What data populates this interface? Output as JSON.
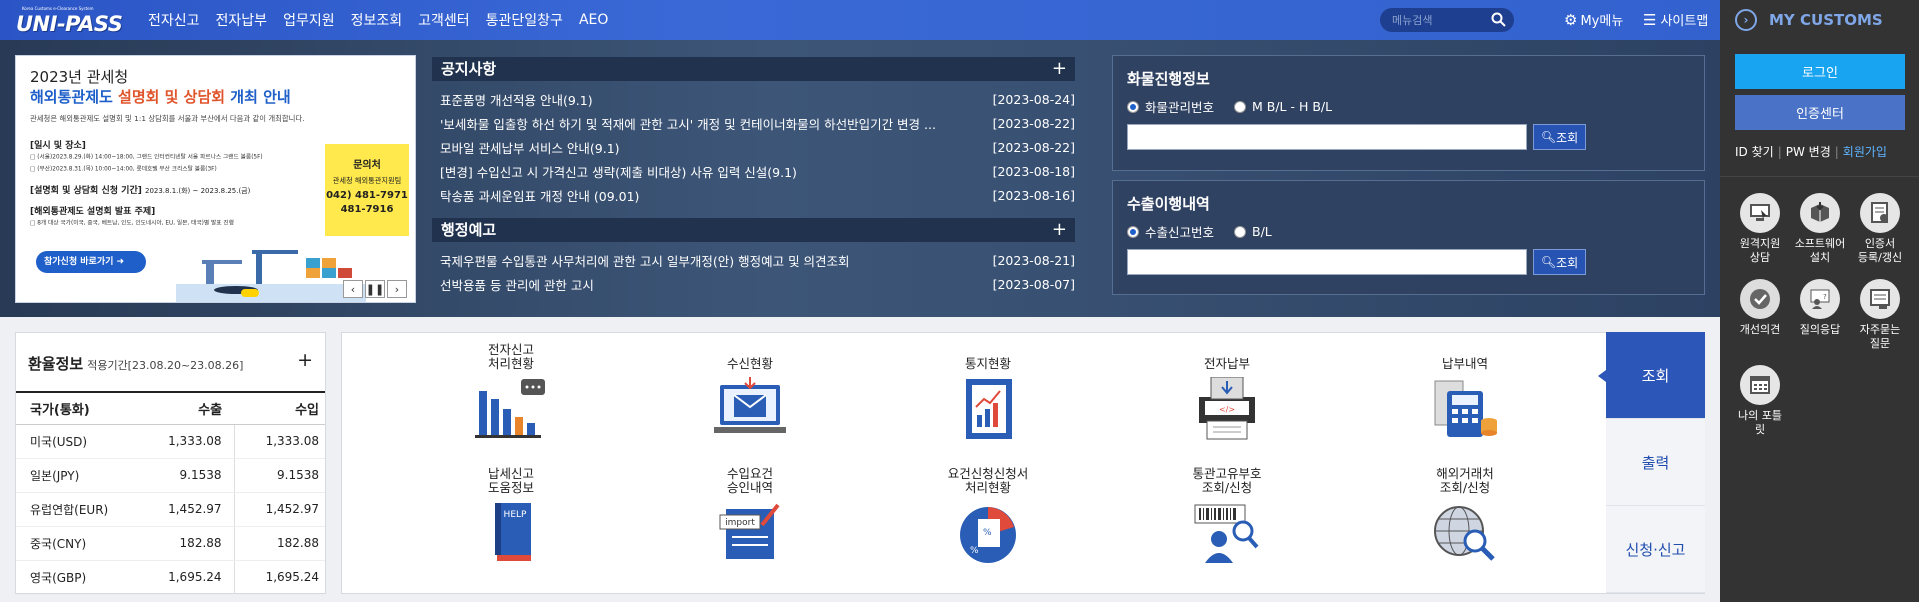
{
  "header": {
    "logo_text": "UNI-PASS",
    "logo_subtitle": "Korea Customs e-Clearance System",
    "nav": [
      "전자신고",
      "전자납부",
      "업무지원",
      "정보조회",
      "고객센터",
      "통관단일창구",
      "AEO"
    ],
    "search_placeholder": "메뉴검색",
    "my_menu": "My메뉴",
    "sitemap": "사이트맵"
  },
  "banner": {
    "line1": "2023년 관세청",
    "line2a": "해외통관제도 ",
    "line2b": "설명회 및 상담회",
    "line2c": " 개최 안내",
    "desc": "관세청은 해외통관제도 설명회 및 1:1 상담회를 서울과 부산에서 다음과 같이 개최합니다.",
    "sec1": "[일시 및 장소]",
    "sec1_l1": "□ (서울)2023.8.29.(화) 14:00~18:00, 그랜드 인터컨티넨탈 서울 파르나스 그랜드 볼룸(5F)",
    "sec1_l2": "□ (부산)2023.8.31.(목) 10:00~14:00, 롯데호텔 부산 크리스탈 볼룸(3F)",
    "sec2": "[설명회 및 상담회 신청 기간]",
    "sec2_val": "2023.8.1.(화) ~ 2023.8.25.(금)",
    "sec3": "[해외통관제도 설명회 발표 주제]",
    "sec3_l1": "□ 8개 대상 국가(미국, 중국, 베트남, 인도, 인도네시아, EU, 일본, 태국)별 발표 진행",
    "contact_title": "문의처",
    "contact_org": "관세청 해외통관지원팀",
    "contact_tel1": "042) 481-7971",
    "contact_tel2": "481-7916",
    "apply_btn": "참가신청 바로가기"
  },
  "notice": {
    "title": "공지사항",
    "items": [
      {
        "title": "표준품명 개선적용 안내(9.1)",
        "date": "[2023-08-24]"
      },
      {
        "title": "'보세화물 입출항 하선 하기 및 적재에 관한 고시' 개정 및 컨테이너화물의 하선반입기간 변경 ...",
        "date": "[2023-08-22]"
      },
      {
        "title": "모바일 관세납부 서비스 안내(9.1)",
        "date": "[2023-08-22]"
      },
      {
        "title": "[변경] 수입신고 시 가격신고 생략(제출 비대상) 사유 입력 신설(9.1)",
        "date": "[2023-08-18]"
      },
      {
        "title": "탁송품 과세운임표 개정 안내 (09.01)",
        "date": "[2023-08-16]"
      }
    ]
  },
  "admin": {
    "title": "행정예고",
    "items": [
      {
        "title": "국제우편물 수입통관 사무처리에 관한 고시 일부개정(안) 행정예고 및 의견조회",
        "date": "[2023-08-21]"
      },
      {
        "title": "선박용품 등 관리에 관한 고시",
        "date": "[2023-08-07]"
      }
    ]
  },
  "cargo": {
    "title": "화물진행정보",
    "radio1": "화물관리번호",
    "radio2": "M B/L - H B/L",
    "button": "조회"
  },
  "export": {
    "title": "수출이행내역",
    "radio1": "수출신고번호",
    "radio2": "B/L",
    "button": "조회"
  },
  "rate": {
    "title": "환율정보",
    "period": "적용기간[23.08.20~23.08.26]",
    "headers": [
      "국가(통화)",
      "수출",
      "수입"
    ],
    "rows": [
      [
        "미국(USD)",
        "1,333.08",
        "1,333.08"
      ],
      [
        "일본(JPY)",
        "9.1538",
        "9.1538"
      ],
      [
        "유럽연합(EUR)",
        "1,452.97",
        "1,452.97"
      ],
      [
        "중국(CNY)",
        "182.88",
        "182.88"
      ],
      [
        "영국(GBP)",
        "1,695.24",
        "1,695.24"
      ]
    ]
  },
  "services": [
    "전자신고\n처리현황",
    "수신현황",
    "통지현황",
    "전자납부",
    "납부내역",
    "납세신고\n도움정보",
    "수입요건\n승인내역",
    "요건신청신청서\n처리현황",
    "통관고유부호\n조회/신청",
    "해외거래처\n조회/신청"
  ],
  "service_icon_text": {
    "help": "HELP",
    "import": "import"
  },
  "tabs": [
    "조회",
    "출력",
    "신청·신고"
  ],
  "sidebar": {
    "title": "MY CUSTOMS",
    "login": "로그인",
    "cert_center": "인증센터",
    "id_find": "ID 찾기",
    "pw_change": "PW 변경",
    "join": "회원가입",
    "quick": [
      "원격지원\n상담",
      "소프트웨어\n설치",
      "인증서\n등록/갱신",
      "개선의견",
      "질의응답",
      "자주묻는\n질문",
      "나의 포틀\n릿"
    ]
  }
}
